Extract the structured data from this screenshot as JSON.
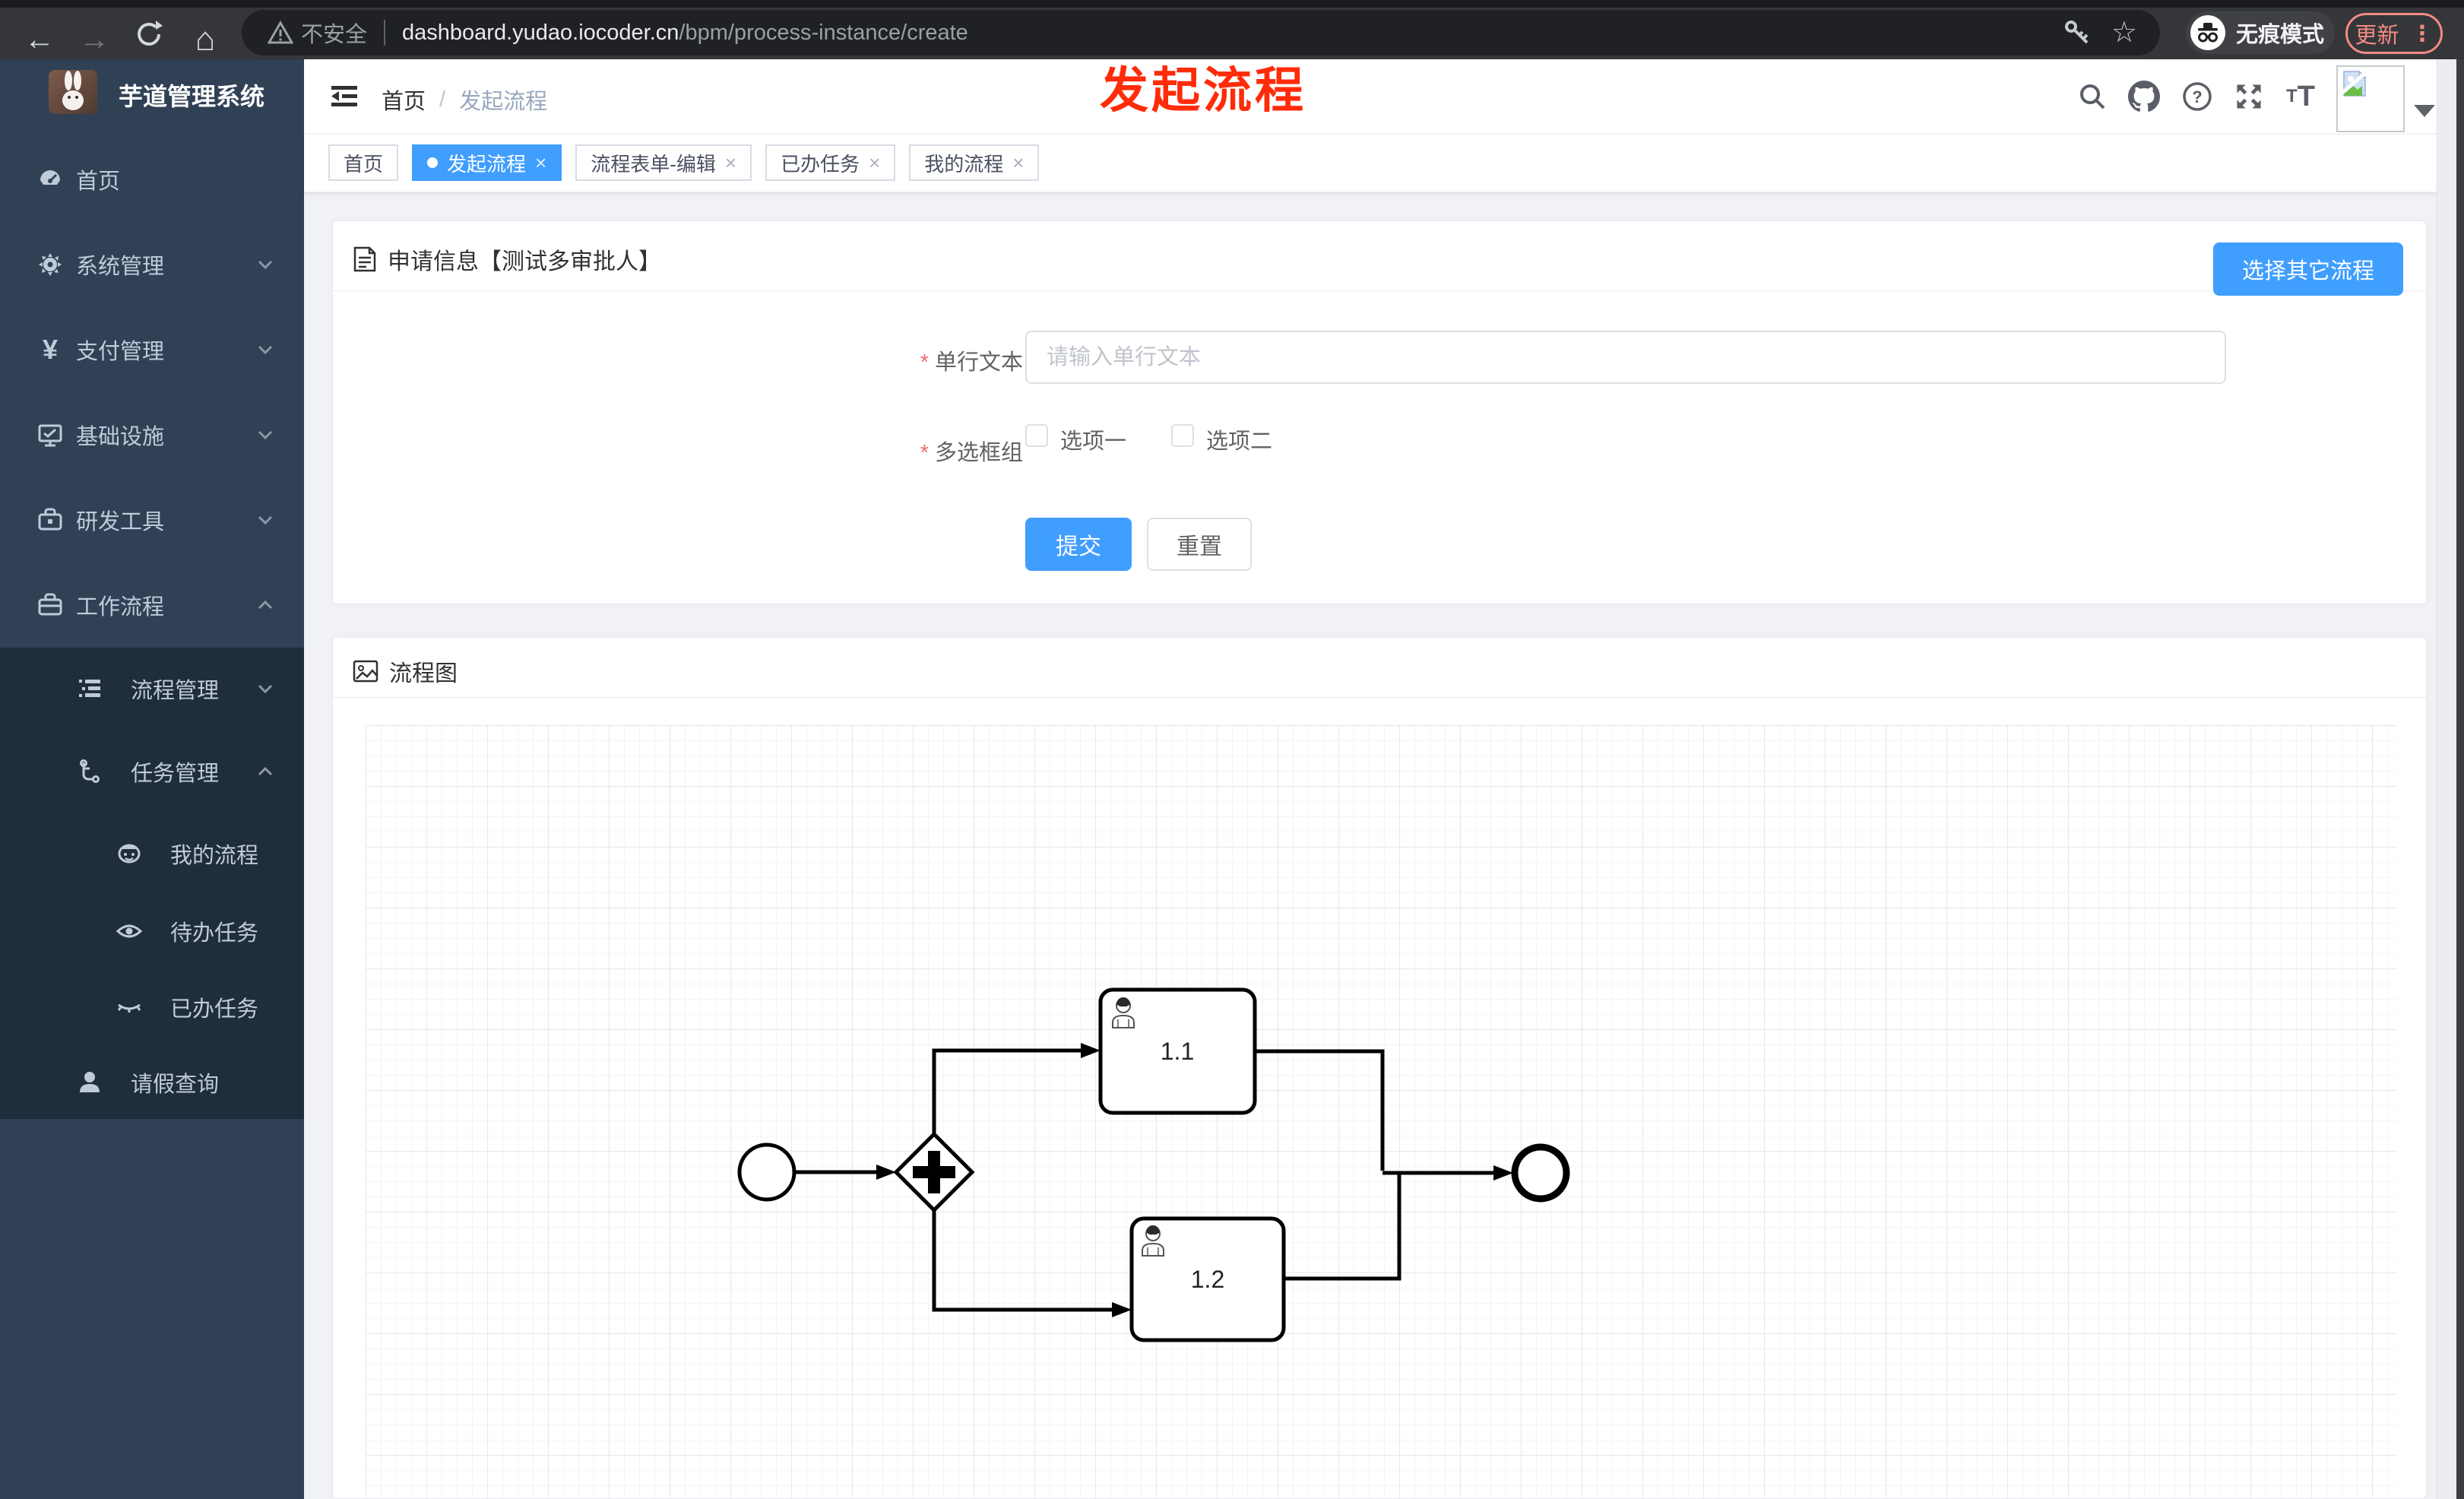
{
  "browser": {
    "security_label": "不安全",
    "url_host": "dashboard.yudao.iocoder.cn",
    "url_path": "/bpm/process-instance/create",
    "incognito_label": "无痕模式",
    "update_label": "更新",
    "icons": {
      "back": "←",
      "forward": "→",
      "home": "⌂",
      "star": "☆",
      "menu_dots": "⋮"
    }
  },
  "annotation": {
    "title": "发起流程"
  },
  "sidebar": {
    "app_title": "芋道管理系统",
    "items": [
      {
        "label": "首页"
      },
      {
        "label": "系统管理"
      },
      {
        "label": "支付管理"
      },
      {
        "label": "基础设施"
      },
      {
        "label": "研发工具"
      },
      {
        "label": "工作流程"
      },
      {
        "label": "流程管理"
      },
      {
        "label": "任务管理"
      },
      {
        "label": "我的流程"
      },
      {
        "label": "待办任务"
      },
      {
        "label": "已办任务"
      },
      {
        "label": "请假查询"
      }
    ],
    "yen_glyph": "¥"
  },
  "header": {
    "breadcrumb": {
      "home": "首页",
      "separator": "/",
      "current": "发起流程"
    },
    "question_glyph": "?",
    "font_icon_small": "T",
    "font_icon_big": "T"
  },
  "tabs": {
    "close_symbol": "×",
    "items": [
      {
        "label": "首页",
        "active": false
      },
      {
        "label": "发起流程",
        "active": true
      },
      {
        "label": "流程表单-编辑",
        "active": false
      },
      {
        "label": "已办任务",
        "active": false
      },
      {
        "label": "我的流程",
        "active": false
      }
    ]
  },
  "form_card": {
    "title": "申请信息【测试多审批人】",
    "select_other_label": "选择其它流程",
    "required_mark": "*",
    "fields": {
      "text": {
        "label": "单行文本",
        "placeholder": "请输入单行文本",
        "value": ""
      },
      "checkbox_group": {
        "label": "多选框组",
        "options": [
          {
            "label": "选项一",
            "checked": false
          },
          {
            "label": "选项二",
            "checked": false
          }
        ]
      }
    },
    "submit_label": "提交",
    "reset_label": "重置"
  },
  "diagram_card": {
    "title": "流程图",
    "chart_data": {
      "type": "bpmn-flow",
      "nodes": [
        {
          "id": "start",
          "type": "start-event",
          "label": ""
        },
        {
          "id": "gateway",
          "type": "parallel-gateway",
          "label": ""
        },
        {
          "id": "task1",
          "type": "user-task",
          "label": "1.1"
        },
        {
          "id": "task2",
          "type": "user-task",
          "label": "1.2"
        },
        {
          "id": "end",
          "type": "end-event",
          "label": ""
        }
      ],
      "flows": [
        [
          "start",
          "gateway"
        ],
        [
          "gateway",
          "task1"
        ],
        [
          "gateway",
          "task2"
        ],
        [
          "task1",
          "end"
        ],
        [
          "task2",
          "end"
        ]
      ]
    }
  },
  "colors": {
    "accent_blue": "#409eff",
    "sidebar_bg": "#304156",
    "sidebar_submenu_bg": "#1f2d3d",
    "sidebar_text": "#bfcbd9",
    "update_red": "#f28b82",
    "annotation_red": "#ff2b09"
  }
}
